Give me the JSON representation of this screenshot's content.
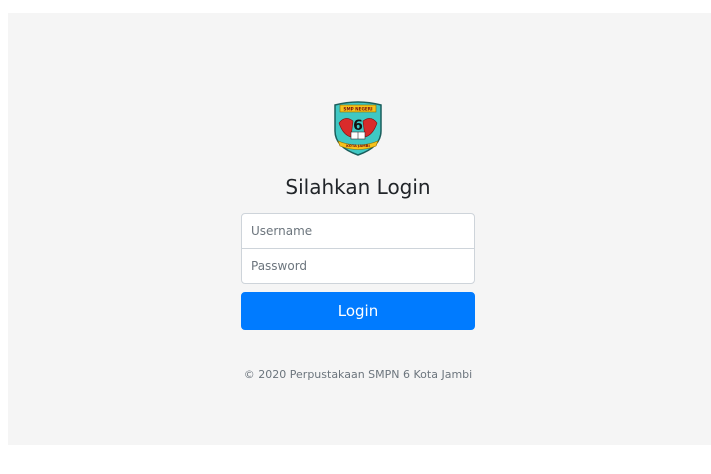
{
  "login": {
    "heading": "Silahkan Login",
    "username_placeholder": "Username",
    "password_placeholder": "Password",
    "submit_label": "Login",
    "footer": "© 2020 Perpustakaan SMPN 6 Kota Jambi"
  },
  "logo": {
    "text_top": "SMP NEGERI",
    "text_number": "6",
    "text_bottom": "KOTA JAMBI"
  },
  "colors": {
    "primary": "#007bff",
    "page_background": "#f5f5f5",
    "text": "#212529",
    "muted": "#6c757d"
  }
}
